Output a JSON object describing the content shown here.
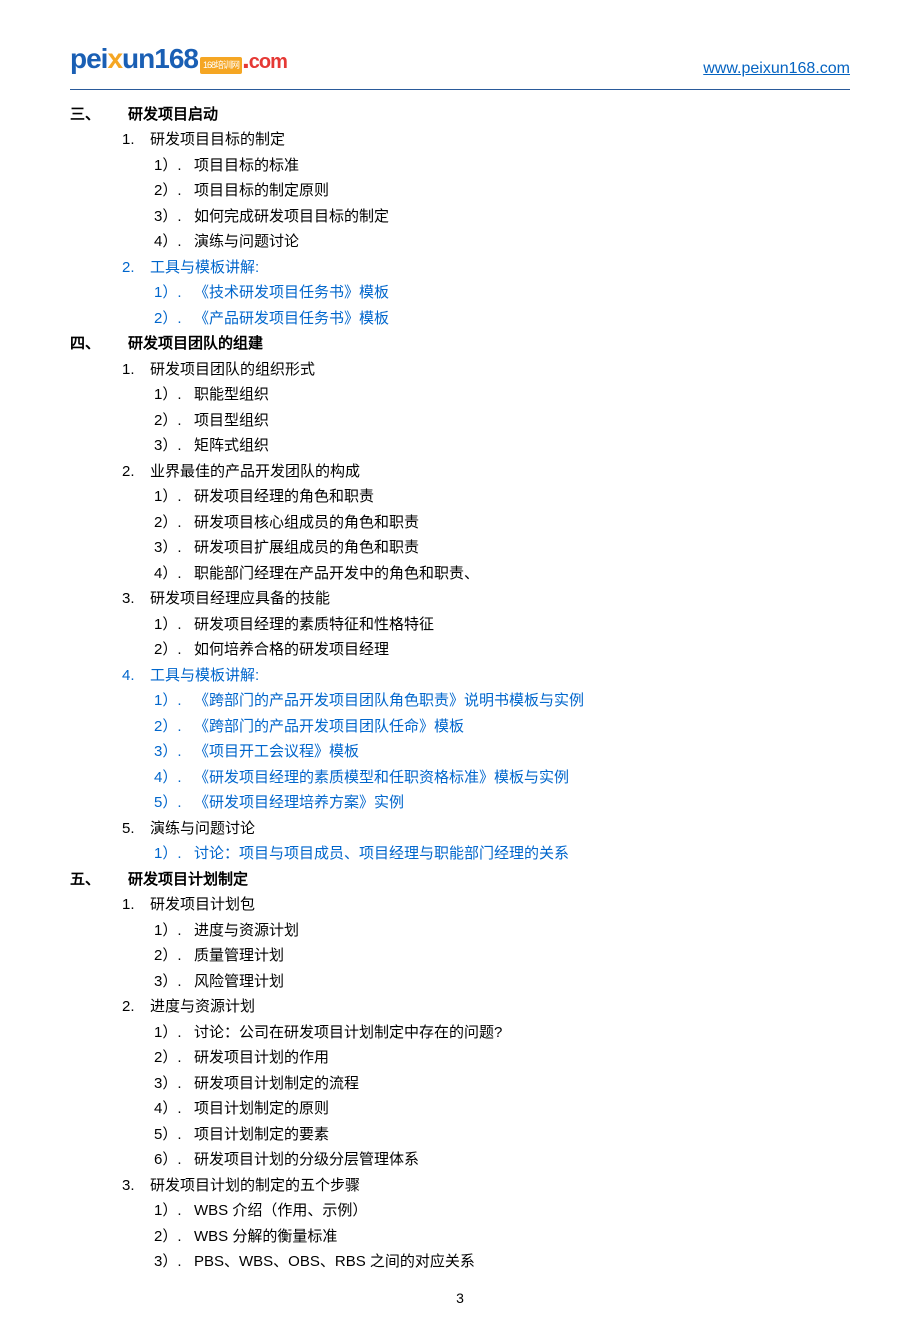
{
  "header": {
    "logo_pei": "pei",
    "logo_x": "x",
    "logo_un": "un",
    "logo_168": "168",
    "logo_badge": "168培训网",
    "logo_dot": ".",
    "logo_com": "com",
    "url": "www.peixun168.com"
  },
  "sections": [
    {
      "num": "三、",
      "title": "研发项目启动",
      "items": [
        {
          "num": "1.",
          "title": "研发项目目标的制定",
          "blue": false,
          "subs": [
            {
              "num": "1）.",
              "text": "项目目标的标准",
              "blue": false
            },
            {
              "num": "2）.",
              "text": "项目目标的制定原则",
              "blue": false
            },
            {
              "num": "3）.",
              "text": "如何完成研发项目目标的制定",
              "blue": false
            },
            {
              "num": "4）.",
              "text": "演练与问题讨论",
              "blue": false
            }
          ]
        },
        {
          "num": "2.",
          "title": "工具与模板讲解:",
          "blue": true,
          "subs": [
            {
              "num": "1）.",
              "text": "《技术研发项目任务书》模板",
              "blue": true
            },
            {
              "num": "2）.",
              "text": "《产品研发项目任务书》模板",
              "blue": true
            }
          ]
        }
      ]
    },
    {
      "num": "四、",
      "title": "研发项目团队的组建",
      "items": [
        {
          "num": "1.",
          "title": "研发项目团队的组织形式",
          "blue": false,
          "subs": [
            {
              "num": "1）.",
              "text": "职能型组织",
              "blue": false
            },
            {
              "num": "2）.",
              "text": "项目型组织",
              "blue": false
            },
            {
              "num": "3）.",
              "text": "矩阵式组织",
              "blue": false
            }
          ]
        },
        {
          "num": "2.",
          "title": "业界最佳的产品开发团队的构成",
          "blue": false,
          "subs": [
            {
              "num": "1）.",
              "text": "研发项目经理的角色和职责",
              "blue": false
            },
            {
              "num": "2）.",
              "text": "研发项目核心组成员的角色和职责",
              "blue": false
            },
            {
              "num": "3）.",
              "text": "研发项目扩展组成员的角色和职责",
              "blue": false
            },
            {
              "num": "4）.",
              "text": "职能部门经理在产品开发中的角色和职责、",
              "blue": false
            }
          ]
        },
        {
          "num": "3.",
          "title": "研发项目经理应具备的技能",
          "blue": false,
          "subs": [
            {
              "num": "1）.",
              "text": "研发项目经理的素质特征和性格特征",
              "blue": false
            },
            {
              "num": "2）.",
              "text": "如何培养合格的研发项目经理",
              "blue": false
            }
          ]
        },
        {
          "num": "4.",
          "title": "工具与模板讲解:",
          "blue": true,
          "subs": [
            {
              "num": "1）.",
              "text": "《跨部门的产品开发项目团队角色职责》说明书模板与实例",
              "blue": true
            },
            {
              "num": "2）.",
              "text": "《跨部门的产品开发项目团队任命》模板",
              "blue": true
            },
            {
              "num": "3）.",
              "text": "《项目开工会议程》模板",
              "blue": true
            },
            {
              "num": "4）.",
              "text": "《研发项目经理的素质模型和任职资格标准》模板与实例",
              "blue": true
            },
            {
              "num": "5）.",
              "text": "《研发项目经理培养方案》实例",
              "blue": true
            }
          ]
        },
        {
          "num": "5.",
          "title": "演练与问题讨论",
          "blue": false,
          "subs": [
            {
              "num": "1）.",
              "text": "讨论：项目与项目成员、项目经理与职能部门经理的关系",
              "blue": true
            }
          ]
        }
      ]
    },
    {
      "num": "五、",
      "title": "研发项目计划制定",
      "items": [
        {
          "num": "1.",
          "title": "研发项目计划包",
          "blue": false,
          "subs": [
            {
              "num": "1）.",
              "text": "进度与资源计划",
              "blue": false
            },
            {
              "num": "2）.",
              "text": "质量管理计划",
              "blue": false
            },
            {
              "num": "3）.",
              "text": "风险管理计划",
              "blue": false
            }
          ]
        },
        {
          "num": "2.",
          "title": "进度与资源计划",
          "blue": false,
          "subs": [
            {
              "num": "1）.",
              "text": "讨论：公司在研发项目计划制定中存在的问题?",
              "blue": false
            },
            {
              "num": "2）.",
              "text": "研发项目计划的作用",
              "blue": false
            },
            {
              "num": "3）.",
              "text": "研发项目计划制定的流程",
              "blue": false
            },
            {
              "num": "4）.",
              "text": "项目计划制定的原则",
              "blue": false
            },
            {
              "num": "5）.",
              "text": "项目计划制定的要素",
              "blue": false
            },
            {
              "num": "6）.",
              "text": "研发项目计划的分级分层管理体系",
              "blue": false
            }
          ]
        },
        {
          "num": "3.",
          "title": "研发项目计划的制定的五个步骤",
          "blue": false,
          "subs": [
            {
              "num": "1）.",
              "text": "WBS 介绍（作用、示例）",
              "blue": false
            },
            {
              "num": "2）.",
              "text": "WBS 分解的衡量标准",
              "blue": false
            },
            {
              "num": "3）.",
              "text": "PBS、WBS、OBS、RBS 之间的对应关系",
              "blue": false
            }
          ]
        }
      ]
    }
  ],
  "page_number": "3"
}
